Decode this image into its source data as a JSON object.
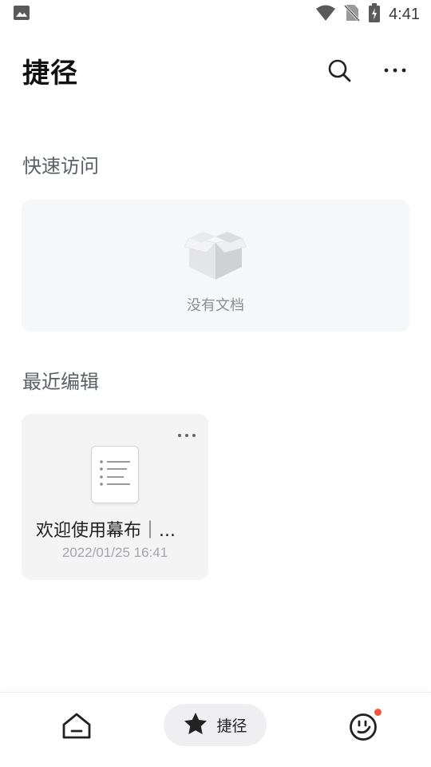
{
  "status_bar": {
    "time": "4:41",
    "icons": [
      "image-icon",
      "wifi-icon",
      "no-sim-icon",
      "battery-charging-icon"
    ]
  },
  "header": {
    "title": "捷径",
    "icons": [
      "search-icon",
      "more-icon"
    ]
  },
  "quick_access": {
    "title": "快速访问",
    "empty_text": "没有文档",
    "empty_icon": "empty-box-icon"
  },
  "recent": {
    "title": "最近编辑",
    "items": [
      {
        "title": "欢迎使用幕布｜...",
        "date": "2022/01/25 16:41",
        "icon": "outline-document-icon"
      }
    ]
  },
  "bottom_nav": {
    "items": [
      {
        "icon": "home-icon",
        "label": ""
      },
      {
        "icon": "star-icon",
        "label": "捷径",
        "active": true
      },
      {
        "icon": "smiley-face-icon",
        "label": "",
        "badge": true
      }
    ]
  },
  "colors": {
    "badge": "#f2553b",
    "active_tab_bg": "#efeff1",
    "card_bg": "#f6f7f9"
  }
}
